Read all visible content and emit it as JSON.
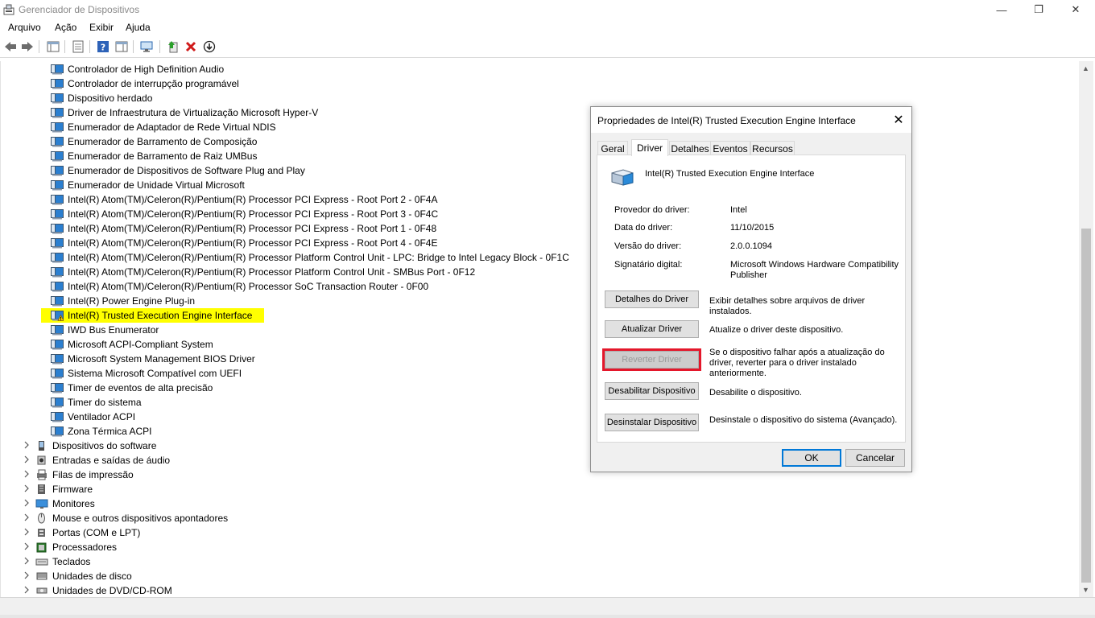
{
  "window": {
    "title": "Gerenciador de Dispositivos",
    "minimize": "—",
    "restore": "❐",
    "close": "✕"
  },
  "menu": [
    "Arquivo",
    "Ação",
    "Exibir",
    "Ajuda"
  ],
  "tree": {
    "children": [
      "Controlador de High Definition Audio",
      "Controlador de interrupção programável",
      "Dispositivo herdado",
      "Driver de Infraestrutura de Virtualização Microsoft Hyper-V",
      "Enumerador de Adaptador de Rede Virtual NDIS",
      "Enumerador de Barramento de Composição",
      "Enumerador de Barramento de Raiz UMBus",
      "Enumerador de Dispositivos de Software Plug and Play",
      "Enumerador de Unidade Virtual Microsoft",
      "Intel(R) Atom(TM)/Celeron(R)/Pentium(R) Processor PCI Express - Root Port 2 - 0F4A",
      "Intel(R) Atom(TM)/Celeron(R)/Pentium(R) Processor PCI Express - Root Port 3 - 0F4C",
      "Intel(R) Atom(TM)/Celeron(R)/Pentium(R) Processor PCI Express - Root Port 1 - 0F48",
      "Intel(R) Atom(TM)/Celeron(R)/Pentium(R) Processor PCI Express - Root Port 4 - 0F4E",
      "Intel(R) Atom(TM)/Celeron(R)/Pentium(R) Processor Platform Control Unit - LPC: Bridge to Intel Legacy Block - 0F1C",
      "Intel(R) Atom(TM)/Celeron(R)/Pentium(R) Processor Platform Control Unit - SMBus Port - 0F12",
      "Intel(R) Atom(TM)/Celeron(R)/Pentium(R) Processor SoC Transaction Router - 0F00",
      "Intel(R) Power Engine Plug-in",
      "Intel(R) Trusted Execution Engine Interface",
      "IWD Bus Enumerator",
      "Microsoft ACPI-Compliant System",
      "Microsoft System Management BIOS Driver",
      "Sistema Microsoft Compatível com UEFI",
      "Timer de eventos de alta precisão",
      "Timer do sistema",
      "Ventilador ACPI",
      "Zona Térmica ACPI"
    ],
    "categories": [
      "Dispositivos do software",
      "Entradas e saídas de áudio",
      "Filas de impressão",
      "Firmware",
      "Monitores",
      "Mouse e outros dispositivos apontadores",
      "Portas (COM e LPT)",
      "Processadores",
      "Teclados",
      "Unidades de disco",
      "Unidades de DVD/CD-ROM"
    ],
    "highlight_color": "#ffff00"
  },
  "dialog": {
    "title": "Propriedades de Intel(R) Trusted Execution Engine Interface",
    "close": "✕",
    "tabs": [
      "Geral",
      "Driver",
      "Detalhes",
      "Eventos",
      "Recursos"
    ],
    "active_tab": "Driver",
    "device_name": "Intel(R) Trusted Execution Engine Interface",
    "provider_label": "Provedor do driver:",
    "provider_value": "Intel",
    "date_label": "Data do driver:",
    "date_value": "11/10/2015",
    "version_label": "Versão do driver:",
    "version_value": "2.0.0.1094",
    "signer_label": "Signatário digital:",
    "signer_value": "Microsoft Windows Hardware Compatibility Publisher",
    "buttons": [
      {
        "label": "Detalhes do Driver",
        "desc": "Exibir detalhes sobre arquivos de driver instalados."
      },
      {
        "label": "Atualizar Driver",
        "desc": "Atualize o driver deste dispositivo."
      },
      {
        "label": "Reverter Driver",
        "desc": "Se o dispositivo falhar após a atualização do driver, reverter para o driver instalado anteriormente."
      },
      {
        "label": "Desabilitar Dispositivo",
        "desc": "Desabilite o dispositivo."
      },
      {
        "label": "Desinstalar Dispositivo",
        "desc": "Desinstale o dispositivo do sistema (Avançado)."
      }
    ],
    "ok": "OK",
    "cancel": "Cancelar"
  },
  "colors": {
    "accent": "#0078d7",
    "highlight_frame": "#e4172b"
  }
}
